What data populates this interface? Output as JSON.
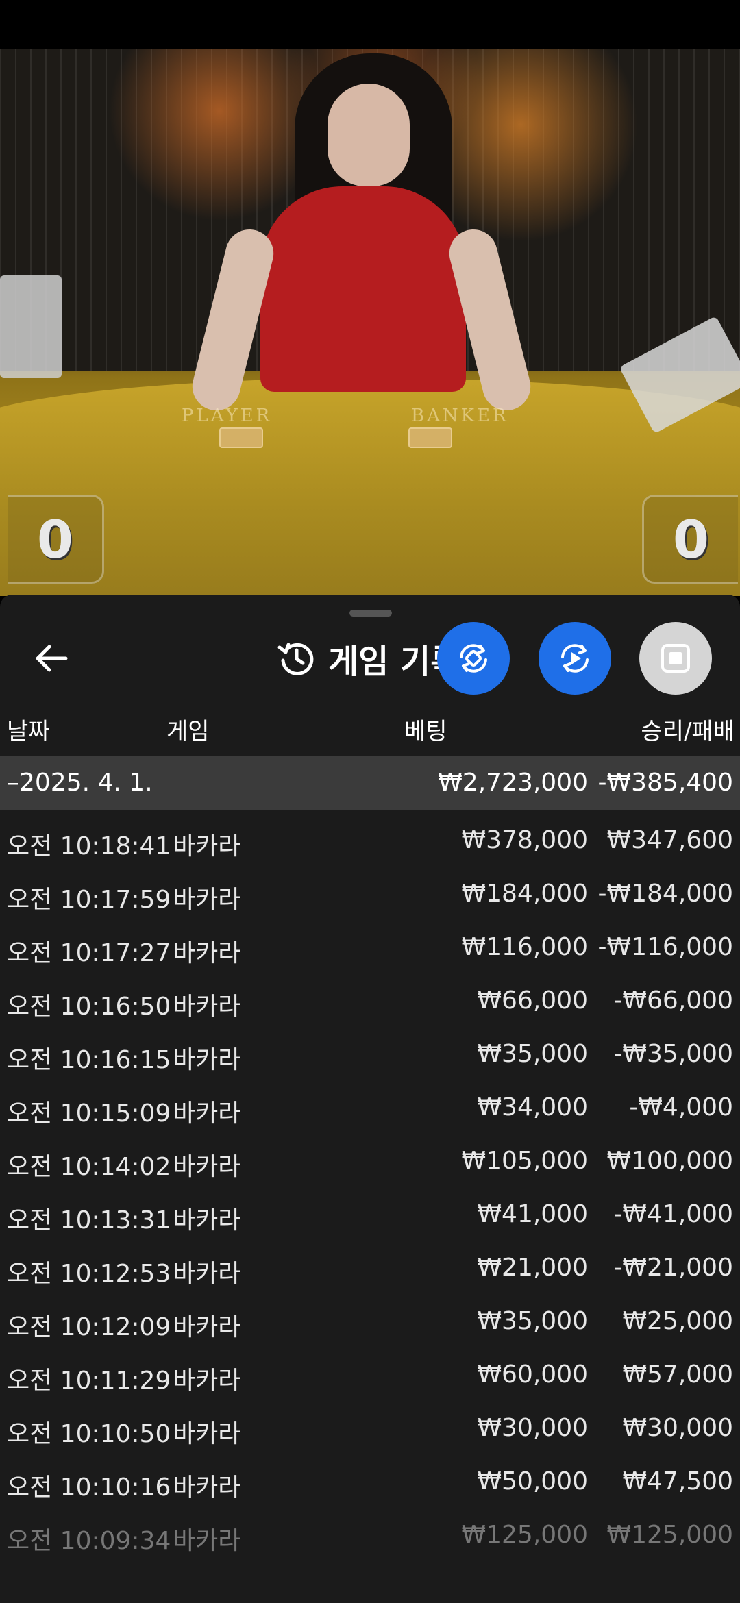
{
  "video": {
    "left_score": "0",
    "right_score": "0",
    "table_marks": [
      "PLAYER",
      "BANKER"
    ]
  },
  "panel": {
    "title": "게임 기록",
    "columns": {
      "date": "날짜",
      "game": "게임",
      "bet": "베팅",
      "winloss": "승리/패배"
    },
    "summary": {
      "date": "–2025. 4. 1.",
      "bet": "₩2,723,000",
      "winloss": "-₩385,400"
    },
    "rows": [
      {
        "time": "오전 10:18:41",
        "game": "바카라",
        "bet": "₩378,000",
        "winloss": "₩347,600"
      },
      {
        "time": "오전 10:17:59",
        "game": "바카라",
        "bet": "₩184,000",
        "winloss": "-₩184,000"
      },
      {
        "time": "오전 10:17:27",
        "game": "바카라",
        "bet": "₩116,000",
        "winloss": "-₩116,000"
      },
      {
        "time": "오전 10:16:50",
        "game": "바카라",
        "bet": "₩66,000",
        "winloss": "-₩66,000"
      },
      {
        "time": "오전 10:16:15",
        "game": "바카라",
        "bet": "₩35,000",
        "winloss": "-₩35,000"
      },
      {
        "time": "오전 10:15:09",
        "game": "바카라",
        "bet": "₩34,000",
        "winloss": "-₩4,000"
      },
      {
        "time": "오전 10:14:02",
        "game": "바카라",
        "bet": "₩105,000",
        "winloss": "₩100,000"
      },
      {
        "time": "오전 10:13:31",
        "game": "바카라",
        "bet": "₩41,000",
        "winloss": "-₩41,000"
      },
      {
        "time": "오전 10:12:53",
        "game": "바카라",
        "bet": "₩21,000",
        "winloss": "-₩21,000"
      },
      {
        "time": "오전 10:12:09",
        "game": "바카라",
        "bet": "₩35,000",
        "winloss": "₩25,000"
      },
      {
        "time": "오전 10:11:29",
        "game": "바카라",
        "bet": "₩60,000",
        "winloss": "₩57,000"
      },
      {
        "time": "오전 10:10:50",
        "game": "바카라",
        "bet": "₩30,000",
        "winloss": "₩30,000"
      },
      {
        "time": "오전 10:10:16",
        "game": "바카라",
        "bet": "₩50,000",
        "winloss": "₩47,500"
      },
      {
        "time": "오전 10:09:34",
        "game": "바카라",
        "bet": "₩125,000",
        "winloss": "₩125,000"
      }
    ]
  },
  "colors": {
    "accent_blue": "#1f6fe8",
    "panel_bg": "#1b1b1b",
    "summary_bg": "#3b3b3b",
    "stop_button_bg": "#d5d5d5"
  },
  "icons": {
    "back": "arrow-left-icon",
    "history": "history-icon",
    "rotate": "rotate-icon",
    "replay": "replay-icon",
    "stop": "stop-icon"
  }
}
